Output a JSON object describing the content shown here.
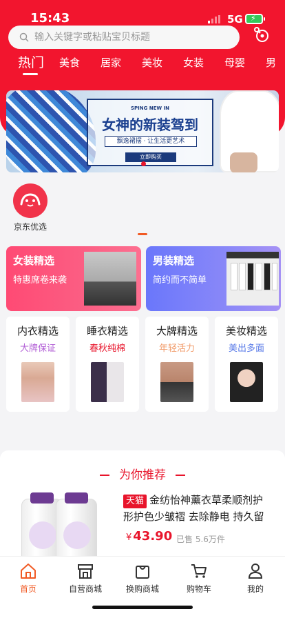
{
  "status": {
    "time": "15:43",
    "network": "5G"
  },
  "search": {
    "placeholder": "输入关键字或粘贴宝贝标题"
  },
  "tabs": [
    "热门",
    "美食",
    "居家",
    "美妆",
    "女装",
    "母婴",
    "男"
  ],
  "banner": {
    "subtitle": "SPING NEW IN",
    "title": "女神的新装驾到",
    "slogan": "飘逸裙摆 · 让生活更艺术",
    "button": "立即购买"
  },
  "channel": {
    "label": "京东优选"
  },
  "promos": [
    {
      "title": "女装精选",
      "subtitle": "特惠席卷来袭"
    },
    {
      "title": "男装精选",
      "subtitle": "简约而不简单"
    }
  ],
  "categories": [
    {
      "title": "内衣精选",
      "subtitle": "大牌保证",
      "color": "#b25fd6"
    },
    {
      "title": "睡衣精选",
      "subtitle": "春秋纯棉",
      "color": "#e8142b"
    },
    {
      "title": "大牌精选",
      "subtitle": "年轻活力",
      "color": "#f19b6a"
    },
    {
      "title": "美妆精选",
      "subtitle": "美出多面",
      "color": "#5a7be8"
    }
  ],
  "recommend": {
    "title": "为你推荐",
    "product": {
      "tag": "天猫",
      "name": "金纺怡神薰衣草柔顺剂护形护色少皱褶 去除静电 持久留",
      "currency": "¥",
      "price": "43.90",
      "sold": "已售 5.6万件"
    }
  },
  "tabbar": [
    "首页",
    "自营商城",
    "换购商城",
    "购物车",
    "我的"
  ],
  "colors": {
    "brand_red": "#f2152e",
    "active_orange": "#f15a24"
  }
}
